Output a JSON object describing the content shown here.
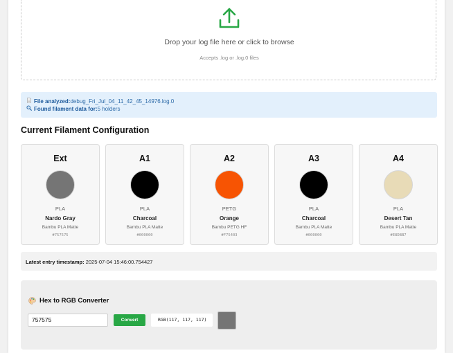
{
  "upload": {
    "icon": "upload-icon",
    "accent": "#28a745",
    "title": "Drop your log file here or click to browse",
    "subtitle": "Accepts .log or .log.0 files"
  },
  "analysis": {
    "file_label": "File analyzed:",
    "file_name": "debug_Fri_Jul_04_11_42_45_14976.log.0",
    "found_label": "Found filament data for:",
    "found_value": "5 holders"
  },
  "config": {
    "title": "Current Filament Configuration",
    "holders": [
      {
        "name": "Ext",
        "type": "PLA",
        "color_name": "Nardo Gray",
        "brand": "Bambu PLA Matte",
        "hex": "#757575"
      },
      {
        "name": "A1",
        "type": "PLA",
        "color_name": "Charcoal",
        "brand": "Bambu PLA Matte",
        "hex": "#000000"
      },
      {
        "name": "A2",
        "type": "PETG",
        "color_name": "Orange",
        "brand": "Bambu PETG HF",
        "hex": "#F75403"
      },
      {
        "name": "A3",
        "type": "PLA",
        "color_name": "Charcoal",
        "brand": "Bambu PLA Matte",
        "hex": "#000000"
      },
      {
        "name": "A4",
        "type": "PLA",
        "color_name": "Desert Tan",
        "brand": "Bambu PLA Matte",
        "hex": "#E8DBB7"
      }
    ]
  },
  "timestamp": {
    "label": "Latest entry timestamp:",
    "value": "2025-07-04 15:46:00.754427"
  },
  "converter": {
    "title": "Hex to RGB Converter",
    "icon": "palette-icon",
    "input_value": "757575",
    "button_label": "Convert",
    "button_color": "#28a745",
    "output": "RGB(117, 117, 117)",
    "preview_color": "#757575"
  }
}
